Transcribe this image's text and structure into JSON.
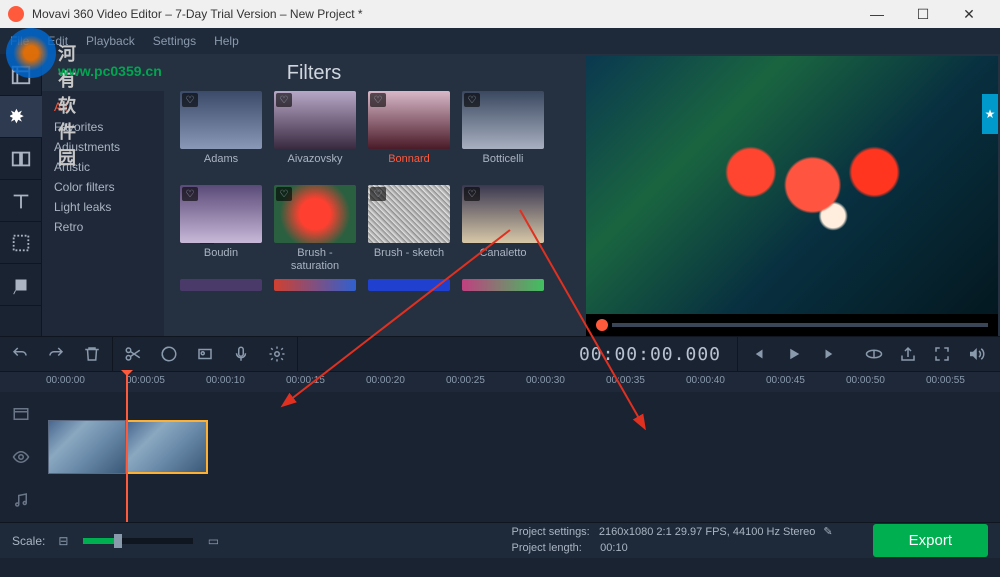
{
  "titlebar": {
    "text": "Movavi 360 Video Editor – 7-Day Trial Version – New Project *"
  },
  "menubar": {
    "file": "File",
    "edit": "Edit",
    "playback": "Playback",
    "settings": "Settings",
    "help": "Help"
  },
  "watermark": {
    "txt1": "河有软件园",
    "txt2": "www.pc0359.cn"
  },
  "panel": {
    "title": "Filters"
  },
  "categories": [
    "All",
    "Favorites",
    "Adjustments",
    "Artistic",
    "Color filters",
    "Light leaks",
    "Retro"
  ],
  "filters": [
    {
      "label": "Adams"
    },
    {
      "label": "Aivazovsky"
    },
    {
      "label": "Bonnard",
      "hl": true
    },
    {
      "label": "Botticelli"
    },
    {
      "label": "Boudin"
    },
    {
      "label": "Brush - saturation"
    },
    {
      "label": "Brush - sketch"
    },
    {
      "label": "Canaletto"
    }
  ],
  "timecode": "00:00:00.000",
  "ruler": [
    "00:00:00",
    "00:00:05",
    "00:00:10",
    "00:00:15",
    "00:00:20",
    "00:00:25",
    "00:00:30",
    "00:00:35",
    "00:00:40",
    "00:00:45",
    "00:00:50",
    "00:00:55"
  ],
  "footer": {
    "scale": "Scale:",
    "settings_label": "Project settings:",
    "settings_value": "2160x1080 2:1 29.97 FPS, 44100 Hz Stereo",
    "length_label": "Project length:",
    "length_value": "00:10",
    "export": "Export"
  }
}
